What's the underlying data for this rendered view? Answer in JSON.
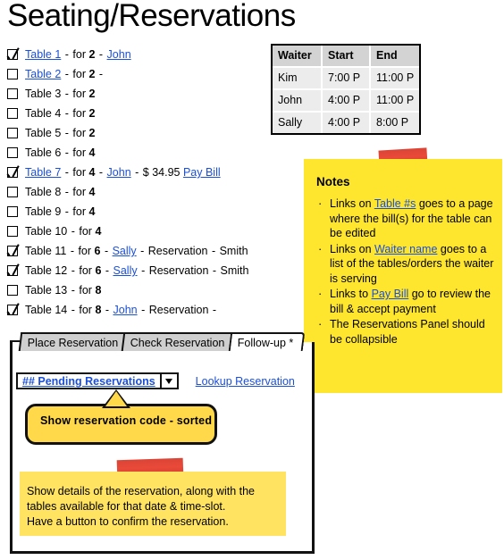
{
  "page_title": "Seating/Reservations",
  "colors": {
    "link": "#1b4fd8",
    "sticky_yellow": "#ffe62e",
    "sticky_yellow_light": "#ffe361",
    "callout_yellow": "#ffd94a",
    "tape_red": "#e8402e",
    "tab_inactive": "#cfcfcf",
    "table_header_gray": "#d3d3d3",
    "table_cell_gray": "#ececec"
  },
  "table_list": [
    {
      "checked": true,
      "table_label": "Table 1",
      "table_is_link": true,
      "for_label": "for",
      "seats": "2",
      "waiter": "John",
      "waiter_is_link": true,
      "amount": "",
      "pay_bill_label": "",
      "reservation_label": "",
      "reservation_name": "",
      "trailing_dash": false
    },
    {
      "checked": false,
      "table_label": "Table 2",
      "table_is_link": true,
      "for_label": "for",
      "seats": "2",
      "waiter": "",
      "waiter_is_link": false,
      "amount": "",
      "pay_bill_label": "",
      "reservation_label": "",
      "reservation_name": "",
      "trailing_dash": true
    },
    {
      "checked": false,
      "table_label": "Table 3",
      "table_is_link": false,
      "for_label": "for",
      "seats": "2",
      "waiter": "",
      "waiter_is_link": false,
      "amount": "",
      "pay_bill_label": "",
      "reservation_label": "",
      "reservation_name": "",
      "trailing_dash": false
    },
    {
      "checked": false,
      "table_label": "Table 4",
      "table_is_link": false,
      "for_label": "for",
      "seats": "2",
      "waiter": "",
      "waiter_is_link": false,
      "amount": "",
      "pay_bill_label": "",
      "reservation_label": "",
      "reservation_name": "",
      "trailing_dash": false
    },
    {
      "checked": false,
      "table_label": "Table 5",
      "table_is_link": false,
      "for_label": "for",
      "seats": "2",
      "waiter": "",
      "waiter_is_link": false,
      "amount": "",
      "pay_bill_label": "",
      "reservation_label": "",
      "reservation_name": "",
      "trailing_dash": false
    },
    {
      "checked": false,
      "table_label": "Table 6",
      "table_is_link": false,
      "for_label": "for",
      "seats": "4",
      "waiter": "",
      "waiter_is_link": false,
      "amount": "",
      "pay_bill_label": "",
      "reservation_label": "",
      "reservation_name": "",
      "trailing_dash": false
    },
    {
      "checked": true,
      "table_label": "Table 7",
      "table_is_link": true,
      "for_label": "for",
      "seats": "4",
      "waiter": "John",
      "waiter_is_link": true,
      "amount": "$ 34.95",
      "pay_bill_label": "Pay Bill",
      "reservation_label": "",
      "reservation_name": "",
      "trailing_dash": false
    },
    {
      "checked": false,
      "table_label": "Table 8",
      "table_is_link": false,
      "for_label": "for",
      "seats": "4",
      "waiter": "",
      "waiter_is_link": false,
      "amount": "",
      "pay_bill_label": "",
      "reservation_label": "",
      "reservation_name": "",
      "trailing_dash": false
    },
    {
      "checked": false,
      "table_label": "Table 9",
      "table_is_link": false,
      "for_label": "for",
      "seats": "4",
      "waiter": "",
      "waiter_is_link": false,
      "amount": "",
      "pay_bill_label": "",
      "reservation_label": "",
      "reservation_name": "",
      "trailing_dash": false
    },
    {
      "checked": false,
      "table_label": "Table 10",
      "table_is_link": false,
      "for_label": "for",
      "seats": "4",
      "waiter": "",
      "waiter_is_link": false,
      "amount": "",
      "pay_bill_label": "",
      "reservation_label": "",
      "reservation_name": "",
      "trailing_dash": false
    },
    {
      "checked": true,
      "table_label": "Table 11",
      "table_is_link": false,
      "for_label": "for",
      "seats": "6",
      "waiter": "Sally",
      "waiter_is_link": true,
      "amount": "",
      "pay_bill_label": "",
      "reservation_label": "Reservation",
      "reservation_name": "Smith",
      "trailing_dash": false
    },
    {
      "checked": true,
      "table_label": "Table 12",
      "table_is_link": false,
      "for_label": "for",
      "seats": "6",
      "waiter": "Sally",
      "waiter_is_link": true,
      "amount": "",
      "pay_bill_label": "",
      "reservation_label": "Reservation",
      "reservation_name": "Smith",
      "trailing_dash": false
    },
    {
      "checked": false,
      "table_label": "Table 13",
      "table_is_link": false,
      "for_label": "for",
      "seats": "8",
      "waiter": "",
      "waiter_is_link": false,
      "amount": "",
      "pay_bill_label": "",
      "reservation_label": "",
      "reservation_name": "",
      "trailing_dash": false
    },
    {
      "checked": true,
      "table_label": "Table 14",
      "table_is_link": false,
      "for_label": "for",
      "seats": "8",
      "waiter": "John",
      "waiter_is_link": true,
      "amount": "",
      "pay_bill_label": "",
      "reservation_label": "Reservation",
      "reservation_name": "",
      "trailing_dash": true
    }
  ],
  "waiter_schedule": {
    "headers": [
      "Waiter",
      "Start",
      "End"
    ],
    "rows": [
      [
        "Kim",
        "7:00 P",
        "11:00 P"
      ],
      [
        "John",
        "4:00 P",
        "11:00 P"
      ],
      [
        "Sally",
        "4:00 P",
        "8:00 P"
      ]
    ]
  },
  "notes": {
    "title": "Notes",
    "bullet": "·",
    "items": [
      {
        "pre": "Links on ",
        "link": "Table #s",
        "post": " goes to a page where the bill(s) for the table can be edited"
      },
      {
        "pre": "Links on ",
        "link": "Waiter name",
        "post": " goes to a list of the tables/orders the waiter is serving"
      },
      {
        "pre": "Links to ",
        "link": "Pay Bill",
        "post": " go to review the bill & accept payment"
      },
      {
        "pre": "The Reservations Panel should be collapsible",
        "link": "",
        "post": ""
      }
    ]
  },
  "reservations_panel": {
    "tabs": [
      {
        "label": "Place Reservation",
        "active": false
      },
      {
        "label": "Check Reservation",
        "active": false
      },
      {
        "label": "Follow-up *",
        "active": true
      }
    ],
    "pending_select_value": "## Pending Reservations",
    "dropdown_arrow_icon": "chevron-down-icon",
    "lookup_link_label": "Lookup Reservation",
    "callout_text": "Show reservation code - sorted",
    "detail_note_lines": [
      "Show details of the reservation, along with the",
      "tables available for that date & time-slot.",
      "Have a button to confirm the reservation."
    ]
  }
}
